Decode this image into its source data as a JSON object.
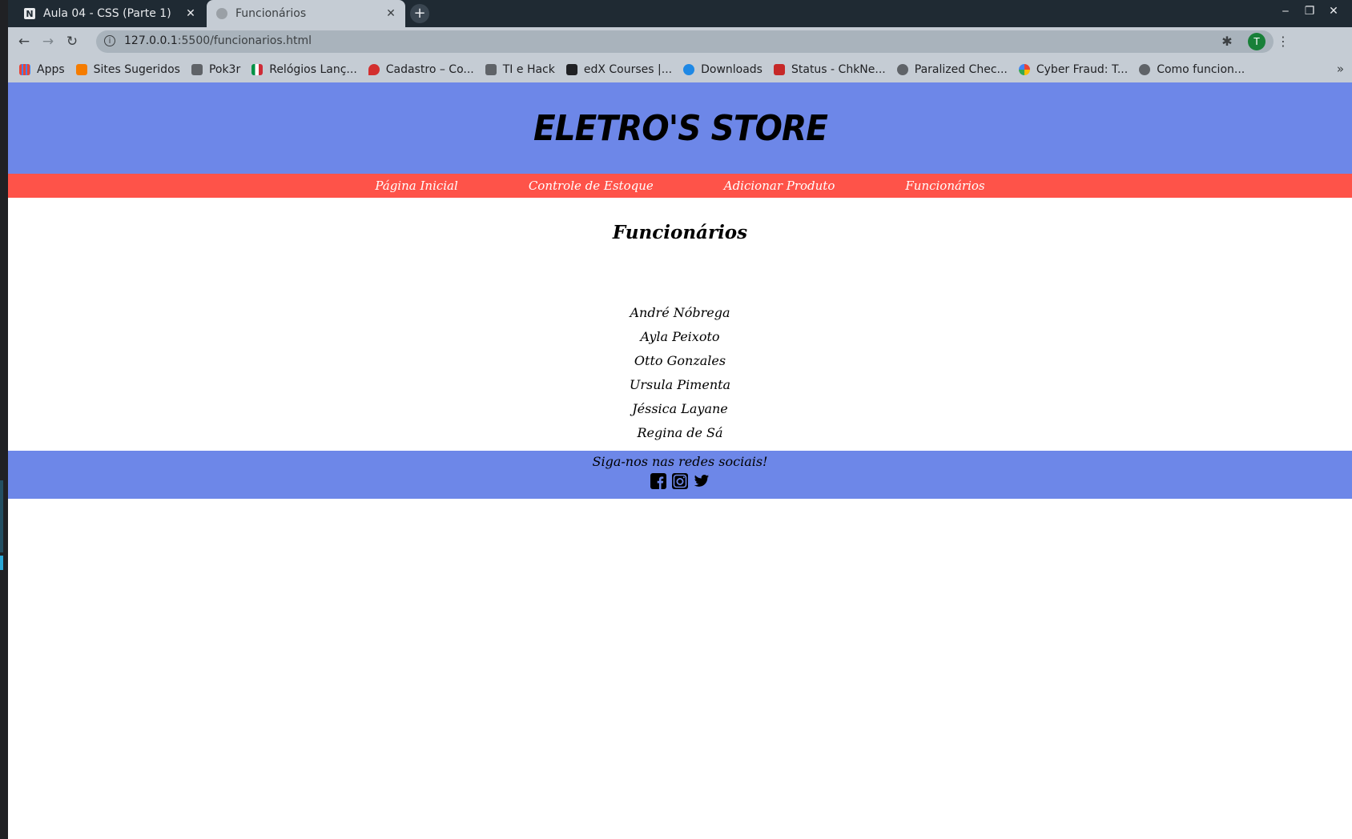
{
  "browser": {
    "tabs": [
      {
        "title": "Aula 04 - CSS (Parte 1)",
        "active": false,
        "favicon": "notion-icon"
      },
      {
        "title": "Funcionários",
        "active": true,
        "favicon": "globe-icon"
      }
    ],
    "url": {
      "host": "127.0.0.1",
      "path": ":5500/funcionarios.html"
    },
    "profile_initial": "T",
    "bookmarks": [
      {
        "label": "Apps",
        "icon": "apps-grid-icon",
        "color": "#4285f4"
      },
      {
        "label": "Sites Sugeridos",
        "icon": "bulb-icon",
        "color": "#f57c00"
      },
      {
        "label": "Pok3r",
        "icon": "folder-icon",
        "color": "#5f6368"
      },
      {
        "label": "Relógios Lanç...",
        "icon": "flag-icon",
        "color": "#009246"
      },
      {
        "label": "Cadastro – Co...",
        "icon": "drop-icon",
        "color": "#d32f2f"
      },
      {
        "label": "TI e Hack",
        "icon": "folder-icon",
        "color": "#5f6368"
      },
      {
        "label": "edX Courses |...",
        "icon": "edx-icon",
        "color": "#202124"
      },
      {
        "label": "Downloads",
        "icon": "person-icon",
        "color": "#1e88e5"
      },
      {
        "label": "Status - ChkNe...",
        "icon": "sn-icon",
        "color": "#c62828"
      },
      {
        "label": "Paralized Chec...",
        "icon": "globe-icon",
        "color": "#5f6368"
      },
      {
        "label": "Cyber Fraud: T...",
        "icon": "google-icon",
        "color": "#4285f4"
      },
      {
        "label": "Como funcion...",
        "icon": "code-icon",
        "color": "#5f6368"
      }
    ]
  },
  "site": {
    "title": "ELETRO'S STORE",
    "nav": [
      "Página Inicial",
      "Controle de Estoque",
      "Adicionar Produto",
      "Funcionários"
    ],
    "heading": "Funcionários",
    "employees": [
      "André Nóbrega",
      "Ayla Peixoto",
      "Otto Gonzales",
      "Ursula Pimenta",
      "Jéssica Layane",
      "Regina de Sá"
    ],
    "footer_text": "Siga-nos nas redes sociais!",
    "social": [
      "facebook-icon",
      "instagram-icon",
      "twitter-icon"
    ]
  },
  "colors": {
    "header": "#6d87e8",
    "nav": "#fe5349",
    "footer": "#6d87e8"
  }
}
